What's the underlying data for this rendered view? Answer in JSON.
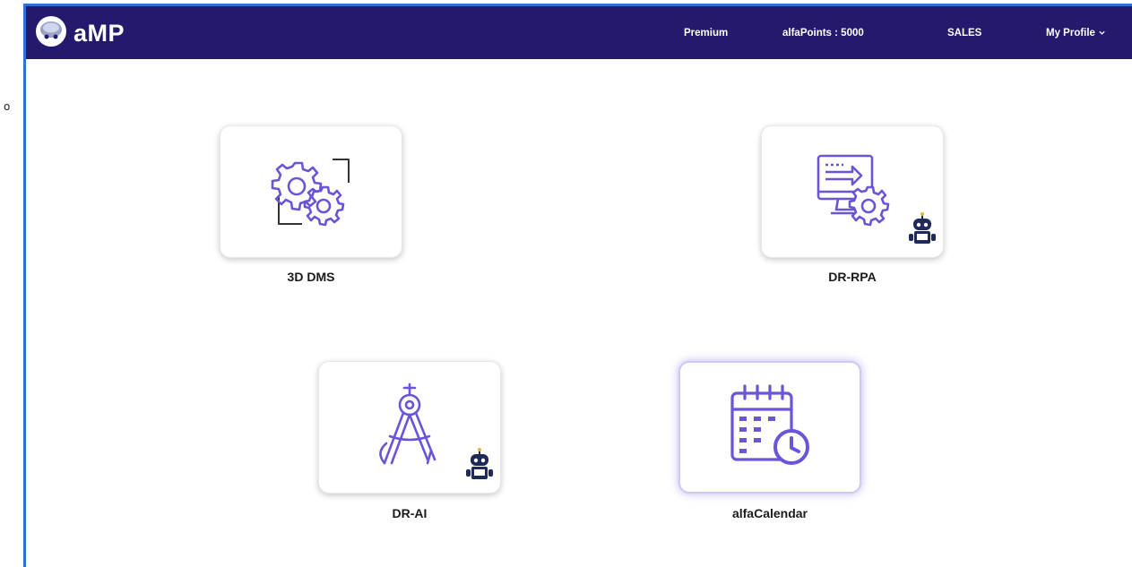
{
  "header": {
    "brand_title": "aMP",
    "nav": {
      "premium": "Premium",
      "alfapoints": "alfaPoints : 5000",
      "sales": "SALES",
      "profile": "My Profile"
    }
  },
  "apps": {
    "dms": {
      "label": "3D DMS"
    },
    "rpa": {
      "label": "DR-RPA"
    },
    "ai": {
      "label": "DR-AI"
    },
    "calendar": {
      "label": "alfaCalendar"
    }
  },
  "colors": {
    "navbar": "#231a6e",
    "accent": "#6a55d8",
    "frame": "#2f6fd6",
    "bot": "#1f2a5a"
  },
  "icons": [
    "brand-logo-icon",
    "chevron-down-icon",
    "gears-icon",
    "computer-gear-icon",
    "compass-icon",
    "calendar-clock-icon",
    "robot-icon"
  ]
}
